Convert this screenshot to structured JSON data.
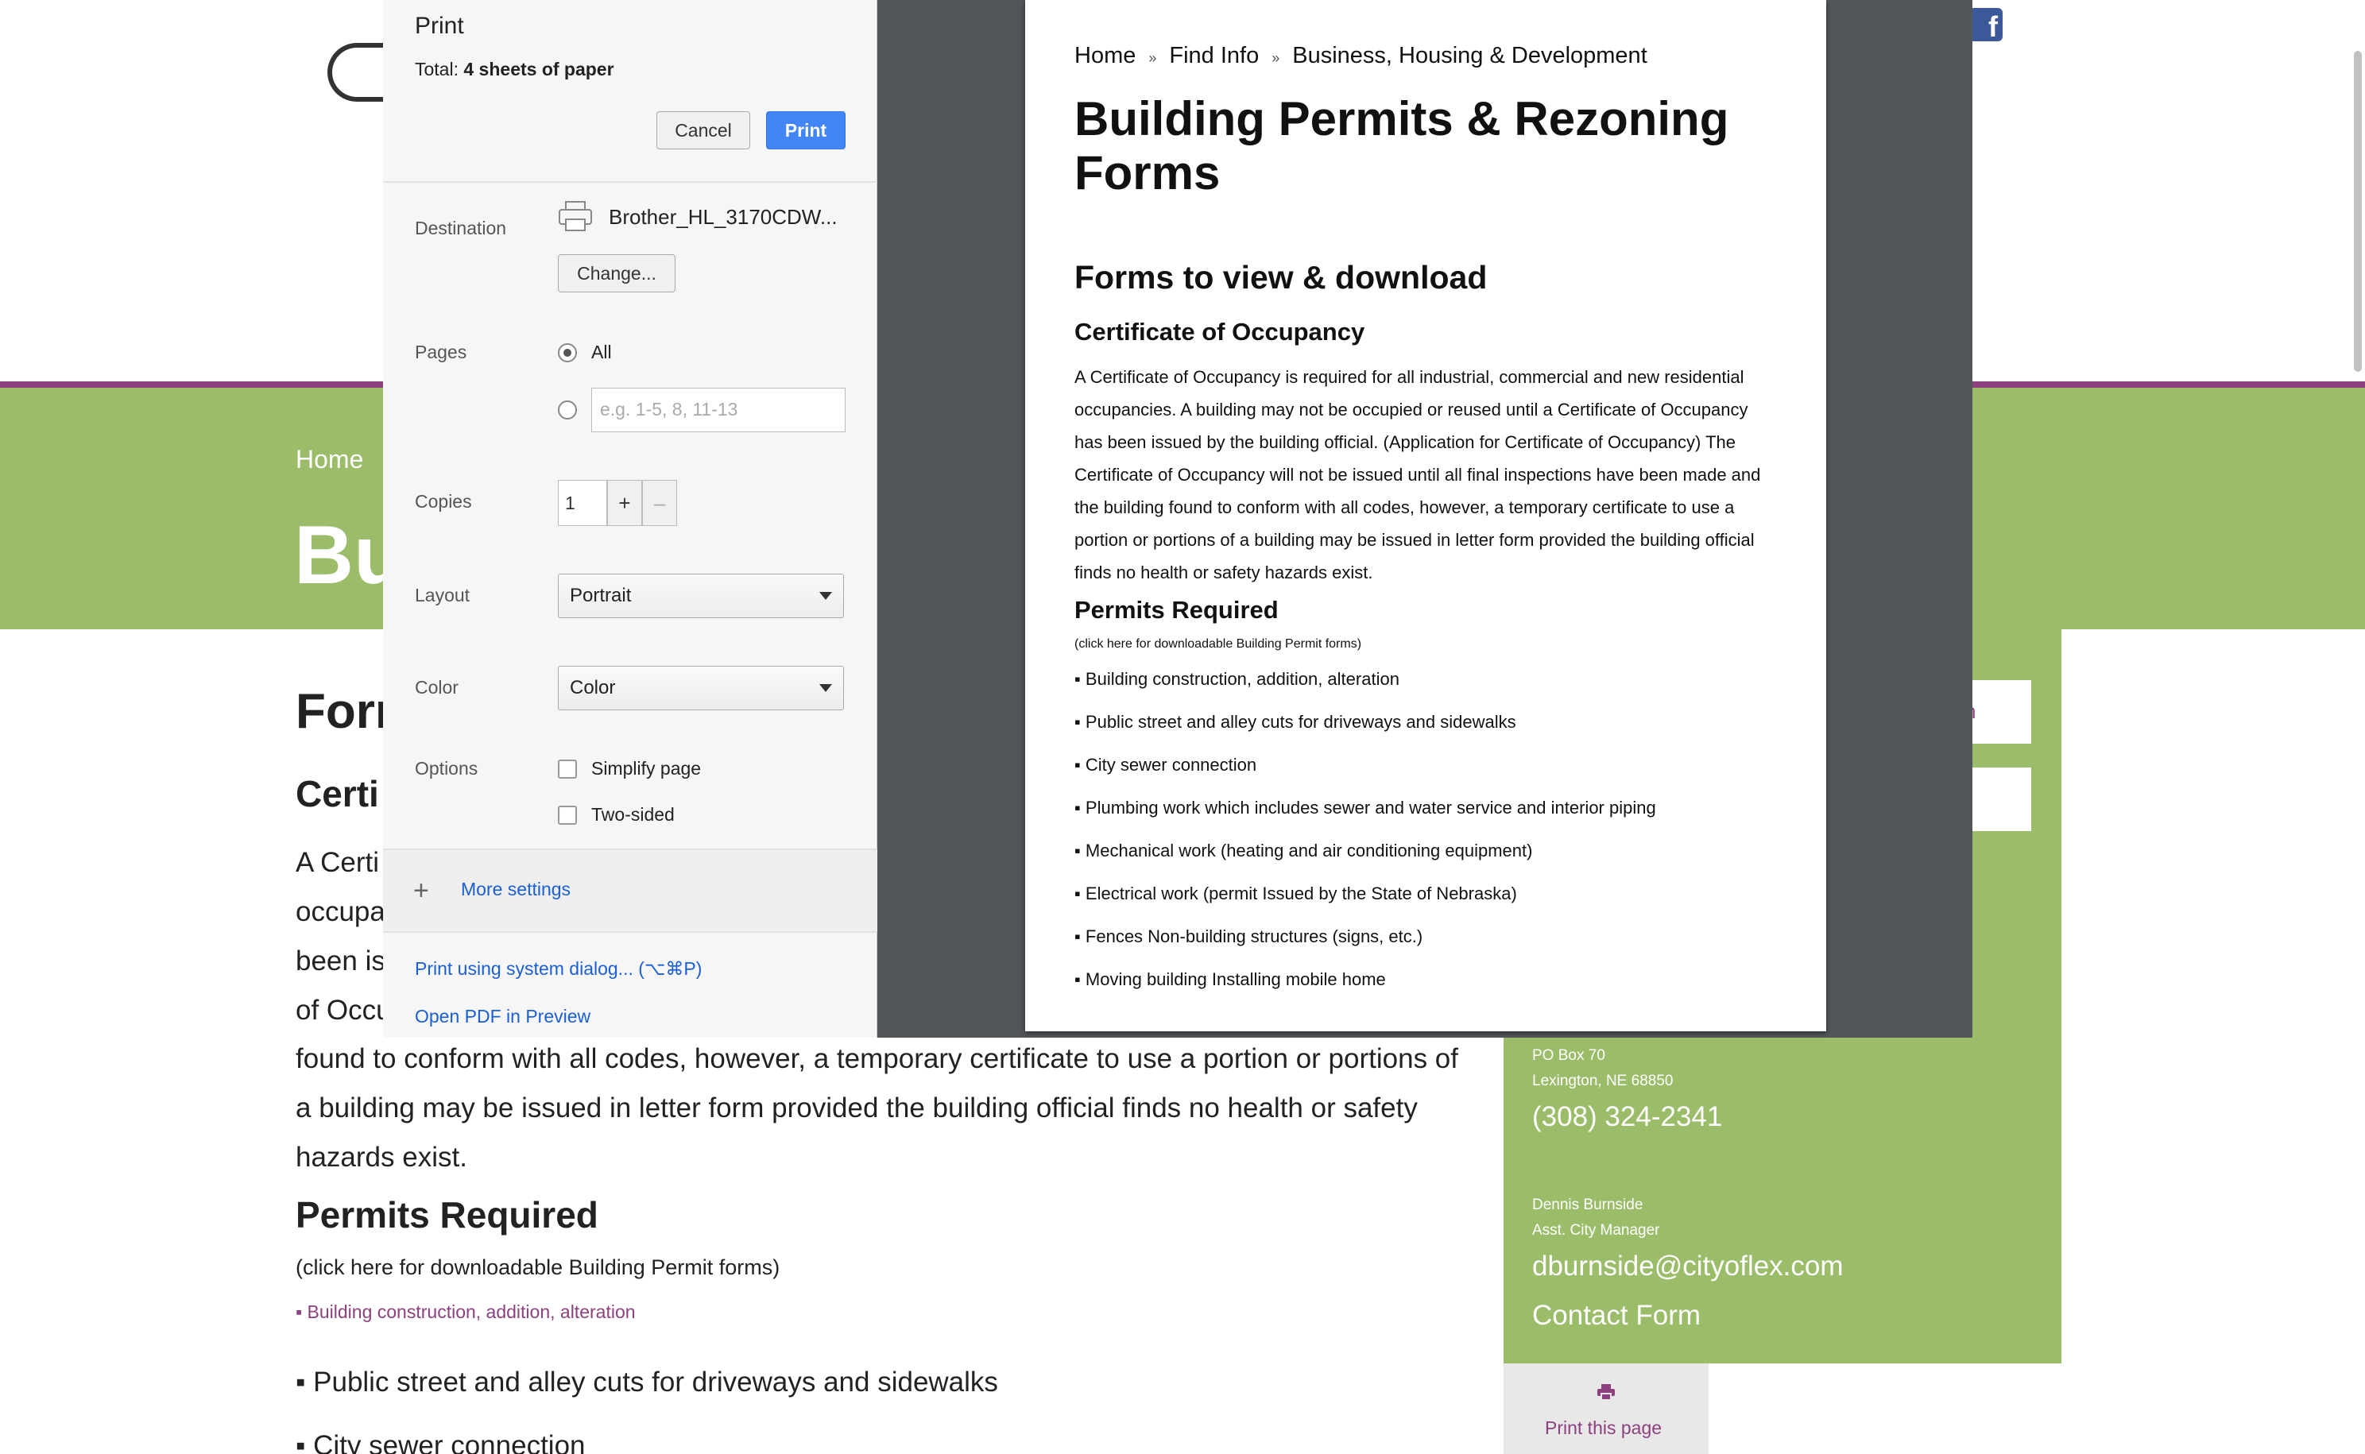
{
  "website": {
    "breadcrumb_home": "Home",
    "page_title_fragment": "Bu",
    "forms_heading_fragment": "Forr",
    "certificate_heading_fragment": "Certi",
    "para_fragments": [
      "A Certi",
      "occupa",
      "been is",
      "of Occu"
    ],
    "para_rest": "found to conform with all codes, however, a temporary certificate to use a portion or portions of a building may be issued in letter form provided the building official finds no health or safety hazards exist.",
    "permits_heading": "Permits Required",
    "permits_note": "(click here for downloadable Building Permit forms)",
    "list": [
      "▪ Building construction, addition, alteration",
      "▪ Public street and alley cuts for driveways and sidewalks",
      "▪ City sewer connection"
    ],
    "sidebar": {
      "box_text": "n",
      "po_box": "PO Box 70",
      "city": "Lexington, NE 68850",
      "phone": "(308) 324-2341",
      "contact_name": "Dennis Burnside",
      "contact_role": "Asst. City Manager",
      "email": "dburnside@cityoflex.com",
      "contact_form": "Contact Form",
      "print_page": "Print this page"
    },
    "accent_color": "#8e3f7e",
    "green_color": "#9bbd6a"
  },
  "print_dialog": {
    "title": "Print",
    "total_label": "Total:",
    "total_value": "4 sheets of paper",
    "cancel_label": "Cancel",
    "print_label": "Print",
    "destination_label": "Destination",
    "destination_value": "Brother_HL_3170CDW...",
    "change_label": "Change...",
    "pages_label": "Pages",
    "pages_all_label": "All",
    "pages_placeholder": "e.g. 1-5, 8, 11-13",
    "copies_label": "Copies",
    "copies_value": "1",
    "plus": "+",
    "minus": "–",
    "layout_label": "Layout",
    "layout_value": "Portrait",
    "color_label": "Color",
    "color_value": "Color",
    "options_label": "Options",
    "simplify_label": "Simplify page",
    "two_sided_label": "Two-sided",
    "more_settings": "More settings",
    "system_dialog": "Print using system dialog... (⌥⌘P)",
    "open_pdf": "Open PDF in Preview",
    "primary_color": "#4285f4"
  },
  "preview": {
    "breadcrumbs": [
      "Home",
      "Find Info",
      "Business, Housing & Development"
    ],
    "crumb_sep": "»",
    "title": "Building Permits & Rezoning Forms",
    "forms_heading": "Forms to view & download",
    "certificate_heading": "Certificate of Occupancy",
    "certificate_text": "A Certificate of Occupancy is required for all industrial, commercial and new residential occupancies. A building may not be occupied or reused until a Certificate of Occupancy has been issued by the building official. (Application for Certificate of Occupancy) The Certificate of Occupancy will not be issued until all final inspections have been made and the building found to conform with all codes, however, a temporary certificate to use a portion or portions of a building may be issued in letter form provided the building official finds no health or safety hazards exist.",
    "permits_heading": "Permits Required",
    "permits_note": "(click here for downloadable Building Permit forms)",
    "items": [
      "▪ Building construction, addition, alteration",
      "▪ Public street and alley cuts for driveways and sidewalks",
      "▪ City sewer connection",
      "▪ Plumbing work which includes sewer and water service and interior piping",
      "▪ Mechanical work (heating and air conditioning equipment)",
      "▪ Electrical work (permit Issued by the State of Nebraska)",
      "▪ Fences Non-building structures (signs, etc.)",
      "▪ Moving building Installing mobile home"
    ]
  }
}
